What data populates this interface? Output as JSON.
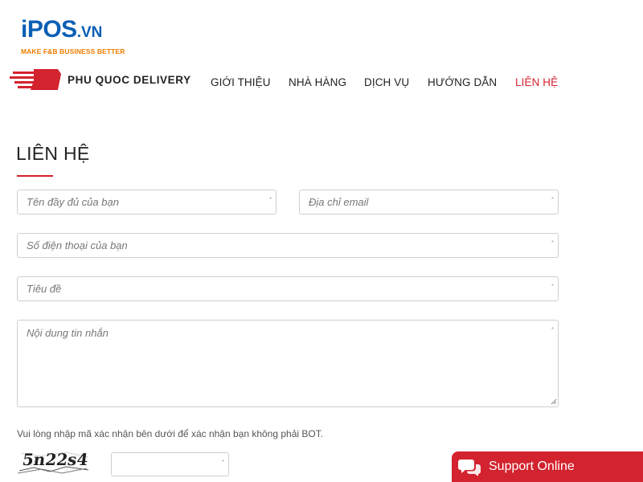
{
  "brand": {
    "logo_main": "iPOS",
    "logo_suffix": ".VN",
    "tagline": "MAKE F&B BUSINESS BETTER",
    "colors": {
      "logo": "#0a5fb4",
      "tagline": "#f07c00"
    }
  },
  "site": {
    "name": "PHU QUOC DELIVERY",
    "accent": "#d3232f"
  },
  "nav": {
    "items": [
      {
        "label": "GIỚI THIỆU",
        "active": false
      },
      {
        "label": "NHÀ HÀNG",
        "active": false
      },
      {
        "label": "DỊCH VỤ",
        "active": false
      },
      {
        "label": "HƯỚNG DẪN",
        "active": false
      },
      {
        "label": "LIÊN HỆ",
        "active": true
      }
    ]
  },
  "page": {
    "title": "LIÊN HỆ"
  },
  "form": {
    "name_placeholder": "Tên đầy đủ của bạn",
    "email_placeholder": "Địa chỉ email",
    "phone_placeholder": "Số điện thoại của bạn",
    "subject_placeholder": "Tiêu đề",
    "message_placeholder": "Nội dung tin nhắn",
    "required_mark": "*",
    "captcha_note": "Vui lòng nhập mã xác nhận bên dưới để xác nhận bạn không phải BOT.",
    "captcha_code": "5n22s4",
    "captcha_value": ""
  },
  "support": {
    "label": "Support Online",
    "icon": "chat-bubbles-icon"
  }
}
